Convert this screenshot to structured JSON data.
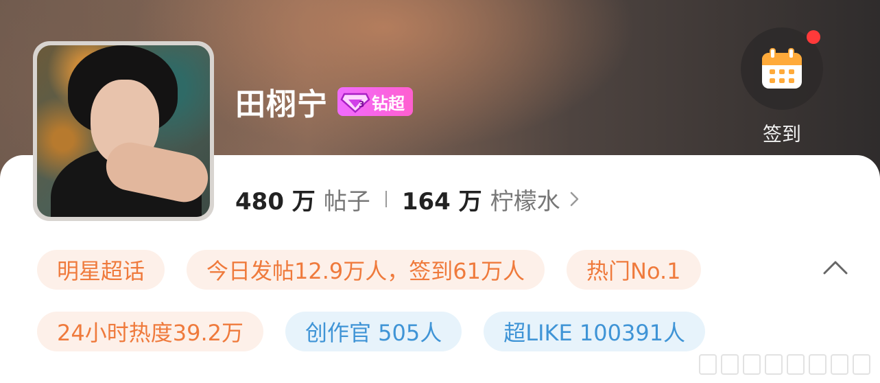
{
  "profile": {
    "name": "田栩宁",
    "badge_label": "钻超"
  },
  "checkin": {
    "label": "签到"
  },
  "stats": {
    "posts_count": "480 万",
    "posts_label": "帖子",
    "fans_count": "164 万",
    "fans_label": "柠檬水"
  },
  "tags": {
    "row1": [
      "明星超话",
      "今日发帖12.9万人，签到61万人",
      "热门No.1"
    ],
    "row2_orange": "24小时热度39.2万",
    "row2_blue": [
      "创作官 505人",
      "超LIKE 100391人"
    ]
  },
  "colors": {
    "tag_orange_text": "#ef7a3c",
    "tag_blue_text": "#3f94d6",
    "badge_pink": "#f06bff",
    "notification_dot": "#ff3a3a"
  },
  "icons": [
    "gem-icon",
    "calendar-icon",
    "chevron-right-icon",
    "chevron-up-icon"
  ]
}
